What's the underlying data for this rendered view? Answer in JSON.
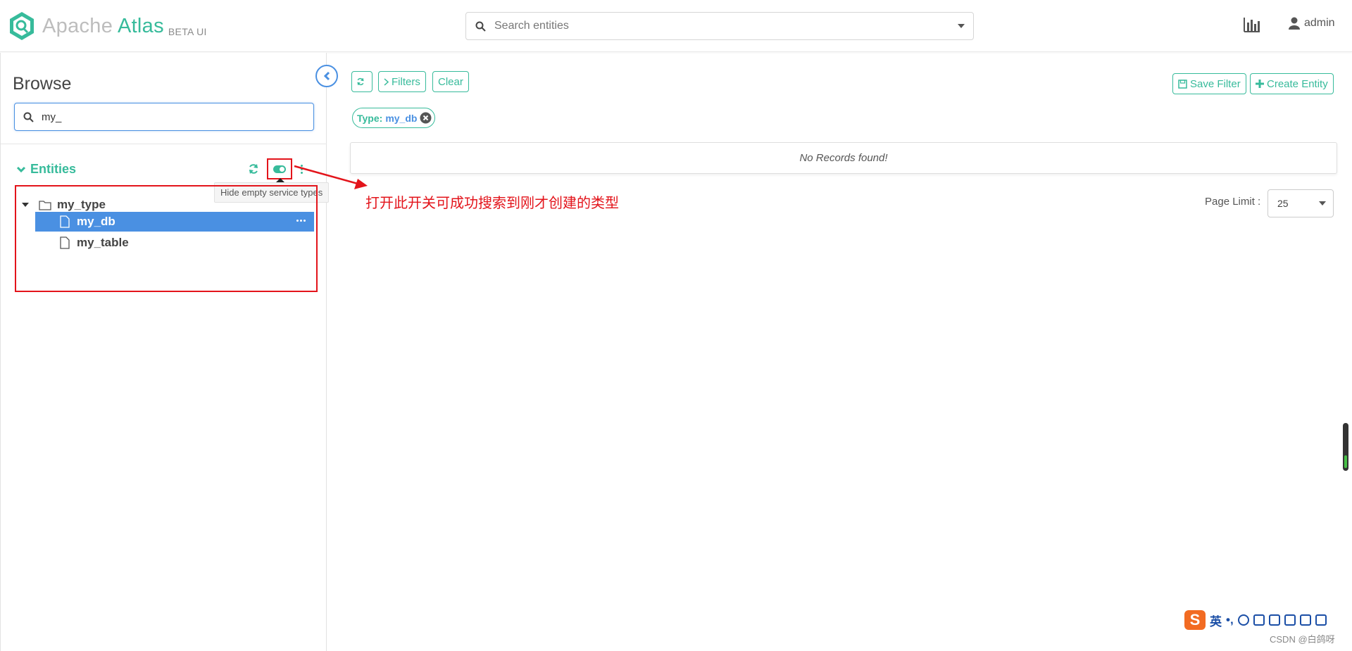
{
  "header": {
    "logo_apache": "Apache",
    "logo_atlas": "Atlas",
    "logo_beta": "BETA UI",
    "search_placeholder": "Search entities",
    "user_name": "admin"
  },
  "sidebar": {
    "title": "Browse",
    "search_value": "my_",
    "entities_label": "Entities",
    "tooltip": "Hide empty service types",
    "tree": {
      "type_label": "my_type",
      "items": [
        {
          "label": "my_db",
          "selected": true
        },
        {
          "label": "my_table",
          "selected": false
        }
      ]
    }
  },
  "main": {
    "filters_label": "Filters",
    "clear_label": "Clear",
    "save_filter_label": "Save Filter",
    "create_entity_label": "Create Entity",
    "chip_key": "Type:",
    "chip_value": "my_db",
    "no_records": "No Records found!",
    "page_limit_label": "Page Limit :",
    "page_limit_value": "25"
  },
  "annotation_text": "打开此开关可成功搜索到刚才创建的类型",
  "ime": {
    "lang": "英",
    "punct": "•,"
  },
  "watermark": "CSDN @白鸽呀",
  "colors": {
    "accent": "#37bb9b",
    "selected": "#4a90e2",
    "annotation": "#e3141b"
  }
}
